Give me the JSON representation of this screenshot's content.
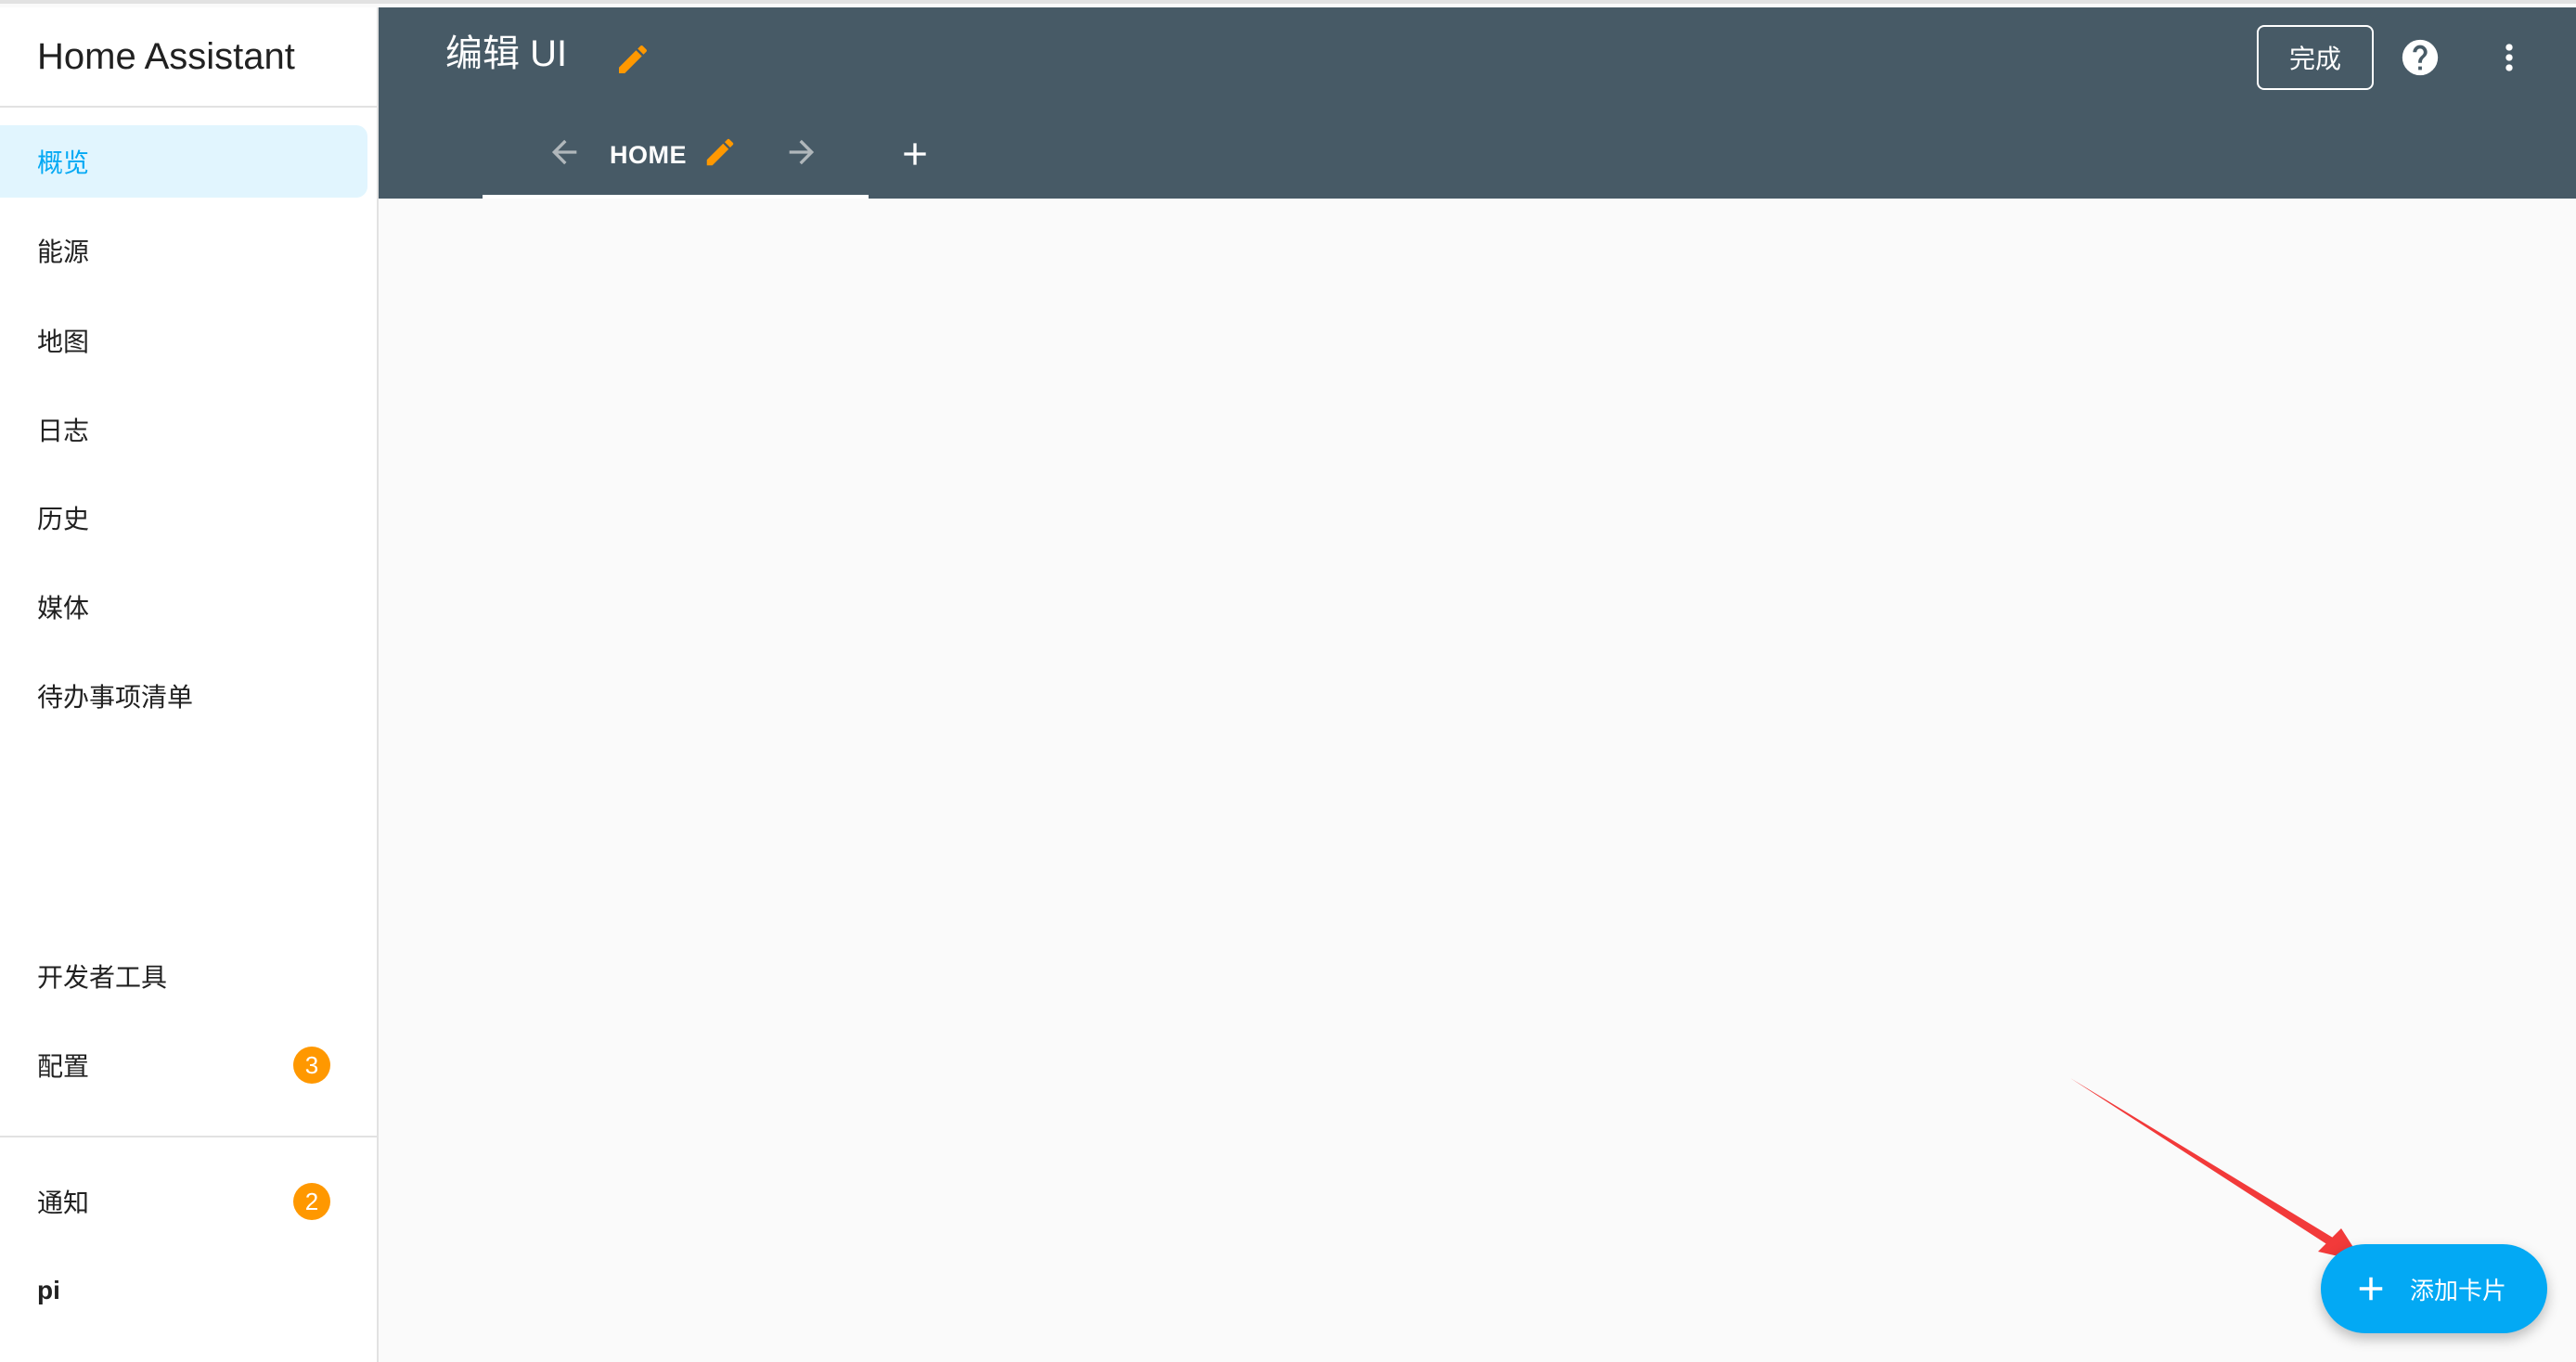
{
  "app": {
    "title": "Home Assistant"
  },
  "sidebar": {
    "items": [
      {
        "label": "概览",
        "active": true
      },
      {
        "label": "能源"
      },
      {
        "label": "地图"
      },
      {
        "label": "日志"
      },
      {
        "label": "历史"
      },
      {
        "label": "媒体"
      },
      {
        "label": "待办事项清单"
      }
    ],
    "bottom_items": [
      {
        "label": "开发者工具"
      },
      {
        "label": "配置",
        "badge": "3"
      }
    ],
    "notifications": {
      "label": "通知",
      "badge": "2"
    },
    "user": {
      "label": "pi"
    }
  },
  "header": {
    "title": "编辑 UI",
    "done_label": "完成",
    "tabs": [
      {
        "label": "HOME",
        "active": true
      }
    ],
    "icons": {
      "edit_title": "pencil-icon",
      "help": "help-circle-icon",
      "menu": "dots-vertical-icon",
      "move_left": "arrow-left-icon",
      "move_right": "arrow-right-icon",
      "edit_tab": "pencil-icon",
      "add_view": "plus-icon"
    }
  },
  "fab": {
    "label": "添加卡片",
    "icon": "plus-icon"
  },
  "colors": {
    "header_bg": "#475a66",
    "accent": "#03a9f4",
    "active_item_bg": "#e1f5fe",
    "badge": "#ff9800",
    "edit_icon": "#ff9800",
    "annotation_arrow": "#f23a3a"
  }
}
